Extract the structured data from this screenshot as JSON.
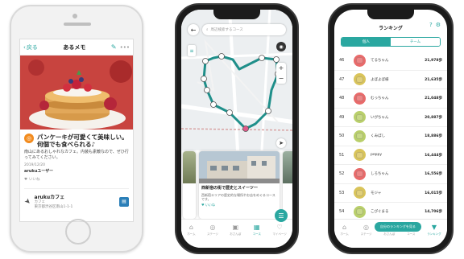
{
  "memo_screen": {
    "back_label": "戻る",
    "title": "あるメモ",
    "edit_icon": "pencil-icon",
    "more_label": "•••",
    "memo_title": "パンケーキが可愛くて美味しい。何個でも食べられる♪",
    "body": "南山にあるおしゃれなカフェ。内装も素敵なので、ぜひ行ってみてください。",
    "date": "2019/12/20",
    "author": "arukuユーザー",
    "likes": "いいね",
    "place": {
      "name": "arukuカフェ",
      "category": "カフェ",
      "address": "東京都渋谷区南山1-1-1"
    },
    "colors": {
      "accent": "#2aa7a0",
      "badge": "#f28b1e"
    }
  },
  "map_screen": {
    "search_placeholder": "周辺検索するコース",
    "cards": [
      {
        "title": "西新宿の街で歴史とスイーツ一",
        "text": "西新宿エリアの歴史的な場所やお店をめぐるコースです。",
        "like": "いいね"
      }
    ],
    "waypoints": [
      "1",
      "2",
      "3",
      "4",
      "5",
      "6",
      "7",
      "8",
      "9",
      "10",
      "11",
      "12",
      "13",
      "14",
      "15"
    ],
    "tabs": [
      {
        "label": "ホーム",
        "icon": "home-icon"
      },
      {
        "label": "ステージ",
        "icon": "stage-icon"
      },
      {
        "label": "おさんぽ",
        "icon": "walk-icon"
      },
      {
        "label": "コース",
        "icon": "course-icon"
      },
      {
        "label": "マイページ",
        "icon": "heart-icon"
      }
    ],
    "active_tab": 3
  },
  "ranking_screen": {
    "title": "ランキング",
    "segments": [
      "個人",
      "チーム"
    ],
    "rows": [
      {
        "rank": "46",
        "name": "てるちゃん",
        "score": "21,978歩",
        "color": "#e86a6a"
      },
      {
        "rank": "47",
        "name": "よぼよぼ様",
        "score": "21,635歩",
        "color": "#d9c45a"
      },
      {
        "rank": "48",
        "name": "むっちゃん",
        "score": "21,048歩",
        "color": "#e86a6a"
      },
      {
        "rank": "49",
        "name": "いがちゃん",
        "score": "20,887歩",
        "color": "#b9cf6a"
      },
      {
        "rank": "50",
        "name": "くみぼし",
        "score": "18,886歩",
        "color": "#b9cf6a"
      },
      {
        "rank": "51",
        "name": "peppy",
        "score": "16,444歩",
        "color": "#d9c45a"
      },
      {
        "rank": "52",
        "name": "しろちゃん",
        "score": "16,556歩",
        "color": "#e86a6a"
      },
      {
        "rank": "53",
        "name": "モジャ",
        "score": "16,015歩",
        "color": "#d9c45a"
      },
      {
        "rank": "54",
        "name": "こぴぐまる",
        "score": "14,706歩",
        "color": "#b9cf6a"
      }
    ],
    "pill_label": "自分のランキングを見る",
    "tabs": [
      {
        "label": "ホーム"
      },
      {
        "label": "ステージ"
      },
      {
        "label": "おさんぽ"
      },
      {
        "label": "コース"
      },
      {
        "label": "ランキング"
      }
    ]
  }
}
